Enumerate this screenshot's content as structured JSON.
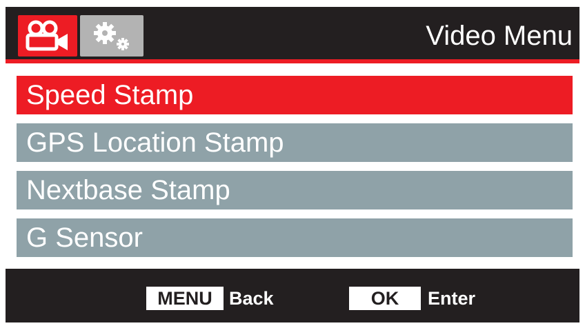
{
  "header": {
    "title": "Video Menu",
    "tabs": [
      {
        "icon": "video-camera-icon",
        "active": true
      },
      {
        "icon": "gears-icon",
        "active": false
      }
    ]
  },
  "menu": {
    "items": [
      {
        "label": "Speed Stamp",
        "selected": true
      },
      {
        "label": "GPS Location Stamp",
        "selected": false
      },
      {
        "label": "Nextbase Stamp",
        "selected": false
      },
      {
        "label": "G Sensor",
        "selected": false
      }
    ]
  },
  "footer": {
    "menu_key": "MENU",
    "menu_action": "Back",
    "ok_key": "OK",
    "ok_action": "Enter"
  },
  "colors": {
    "accent": "#ed1c24",
    "item_bg": "#8fa2a8",
    "bar_bg": "#231f20",
    "inactive_tab": "#b3b3b3"
  }
}
